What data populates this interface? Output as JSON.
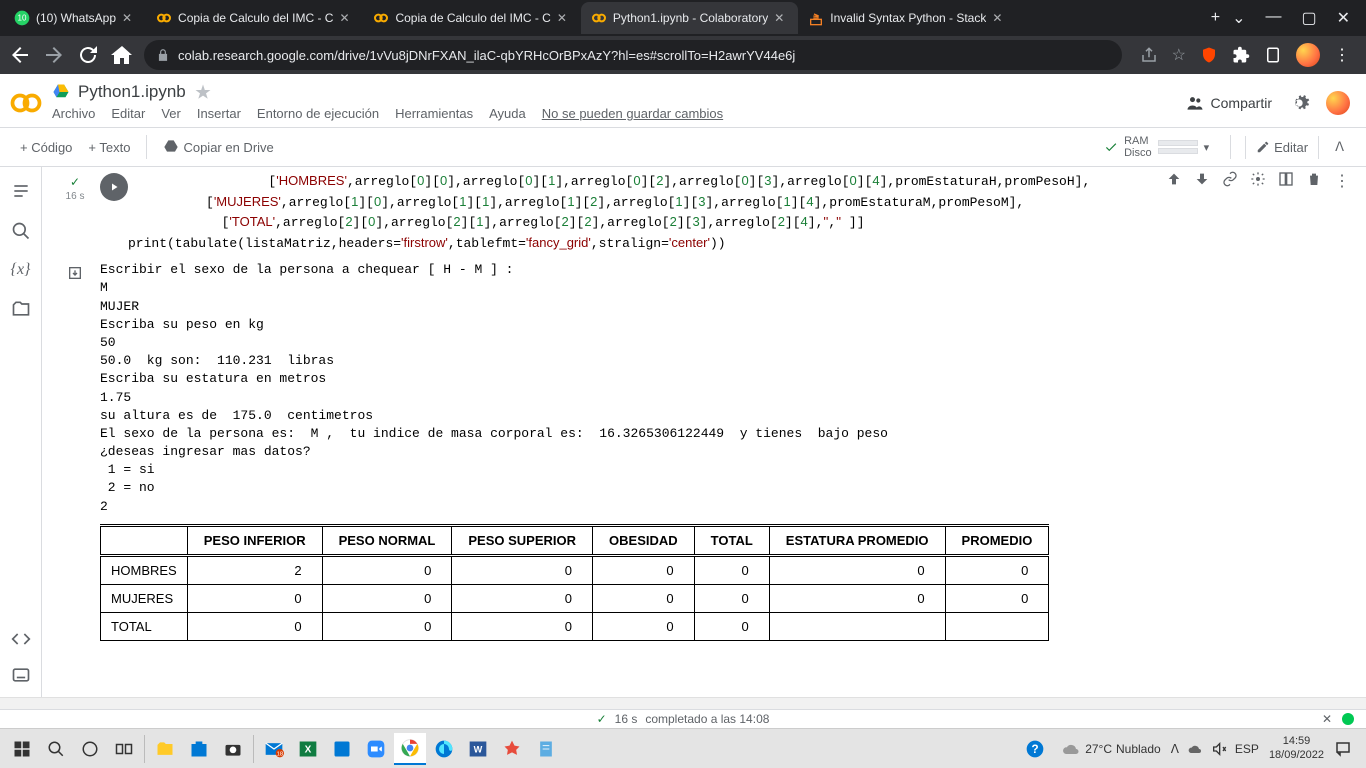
{
  "browser": {
    "tabs": [
      {
        "title": "(10) WhatsApp",
        "favicon": "whatsapp"
      },
      {
        "title": "Copia de Calculo del IMC - C",
        "favicon": "colab"
      },
      {
        "title": "Copia de Calculo del IMC - C",
        "favicon": "colab"
      },
      {
        "title": "Python1.ipynb - Colaboratory",
        "favicon": "colab",
        "active": true
      },
      {
        "title": "Invalid Syntax Python - Stack",
        "favicon": "stack"
      }
    ],
    "url": "colab.research.google.com/drive/1vVu8jDNrFXAN_ilaC-qbYRHcOrBPxAzY?hl=es#scrollTo=H2awrYV44e6j"
  },
  "colab": {
    "doc_title": "Python1.ipynb",
    "menus": [
      "Archivo",
      "Editar",
      "Ver",
      "Insertar",
      "Entorno de ejecución",
      "Herramientas",
      "Ayuda"
    ],
    "save_warning": "No se pueden guardar cambios",
    "share": "Compartir",
    "toolbar": {
      "code": "+ Código",
      "text": "+ Texto",
      "copy_drive": "Copiar en Drive",
      "ram": "RAM",
      "disco": "Disco",
      "editar": "Editar"
    },
    "exec_time_label": "16 s"
  },
  "code_lines": [
    "                  ['HOMBRES',arreglo[0][0],arreglo[0][1],arreglo[0][2],arreglo[0][3],arreglo[0][4],promEstaturaH,promPesoH],",
    "          ['MUJERES',arreglo[1][0],arreglo[1][1],arreglo[1][2],arreglo[1][3],arreglo[1][4],promEstaturaM,promPesoM],",
    "            ['TOTAL',arreglo[2][0],arreglo[2][1],arreglo[2][2],arreglo[2][3],arreglo[2][4],'','' ]]",
    "print(tabulate(listaMatriz,headers='firstrow',tablefmt='fancy_grid',stralign='center'))"
  ],
  "output": {
    "lines": [
      "Escribir el sexo de la persona a chequear [ H - M ] : ",
      "M",
      "MUJER",
      "Escriba su peso en kg",
      "50",
      "50.0  kg son:  110.231  libras",
      "Escriba su estatura en metros",
      "1.75",
      "su altura es de  175.0  centimetros",
      "El sexo de la persona es:  M ,  tu indice de masa corporal es:  16.3265306122449  y tienes  bajo peso",
      "¿deseas ingresar mas datos?",
      " 1 = si",
      " 2 = no",
      "2"
    ],
    "table": {
      "headers": [
        "",
        "PESO INFERIOR",
        "PESO NORMAL",
        "PESO SUPERIOR",
        "OBESIDAD",
        "TOTAL",
        "ESTATURA PROMEDIO",
        "PROMEDIO"
      ],
      "rows": [
        [
          "HOMBRES",
          "2",
          "0",
          "0",
          "0",
          "0",
          "0",
          "0"
        ],
        [
          "MUJERES",
          "0",
          "0",
          "0",
          "0",
          "0",
          "0",
          "0"
        ],
        [
          "TOTAL",
          "0",
          "0",
          "0",
          "0",
          "0",
          "",
          ""
        ]
      ]
    }
  },
  "status_bar": {
    "check": "✓",
    "time": "16 s",
    "text": "completado a las 14:08"
  },
  "taskbar": {
    "weather_temp": "27°C",
    "weather_desc": "Nublado",
    "lang": "ESP",
    "time": "14:59",
    "date": "18/09/2022"
  }
}
